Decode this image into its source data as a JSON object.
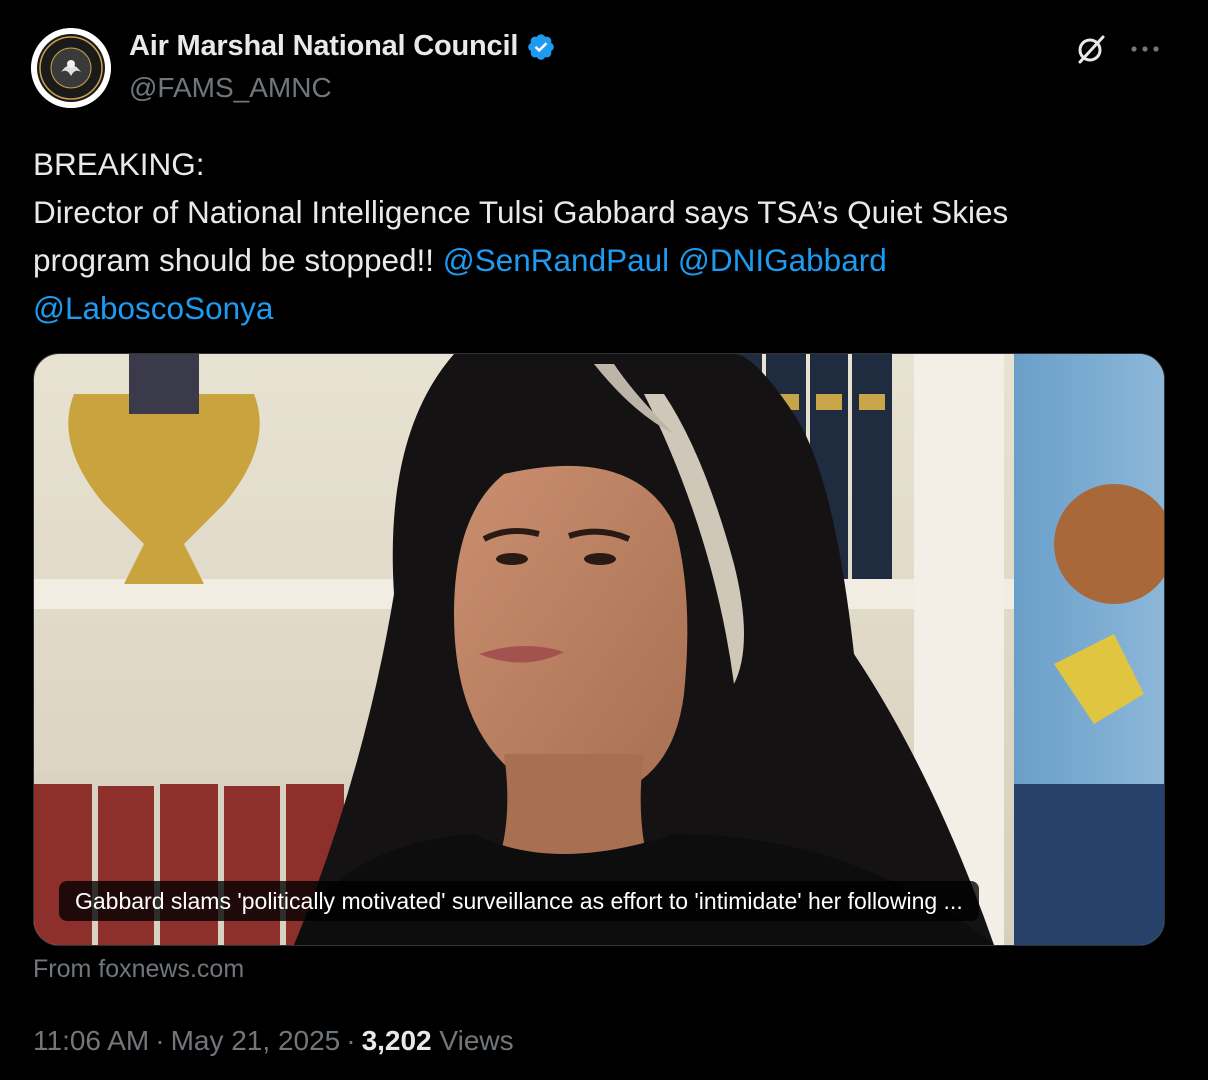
{
  "author": {
    "display_name": "Air Marshal National Council",
    "handle": "@FAMS_AMNC",
    "avatar_icon": "seal-icon",
    "verified_icon": "verified-badge-icon"
  },
  "header_actions": {
    "grok_icon": "grok-icon",
    "more_icon": "more-icon"
  },
  "tweet": {
    "line1": "BREAKING:",
    "line2": "Director of National Intelligence Tulsi Gabbard says TSA’s Quiet Skies",
    "line3_text": "program should be stopped!! ",
    "mention1": "@SenRandPaul",
    "mention2": "@DNIGabbard",
    "mention3": "@LaboscoSonya"
  },
  "card": {
    "caption": "Gabbard slams 'politically motivated' surveillance as effort to 'intimidate' her following ...",
    "source": "From foxnews.com"
  },
  "meta": {
    "time": "11:06 AM",
    "date": "May 21, 2025",
    "views_count": "3,202",
    "views_label": "Views",
    "separator": "·"
  },
  "colors": {
    "background": "#000000",
    "text": "#e7e9ea",
    "secondary": "#71767b",
    "link": "#1d9bf0",
    "verified": "#1d9bf0"
  }
}
